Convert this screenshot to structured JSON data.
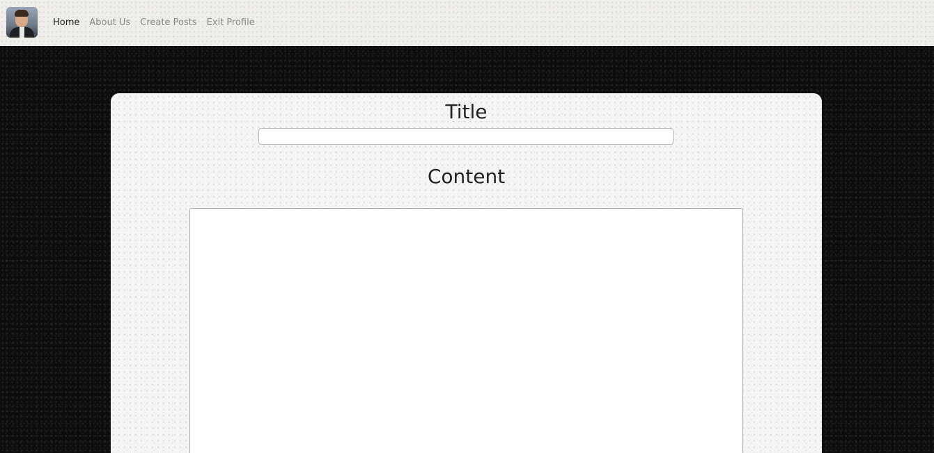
{
  "navbar": {
    "avatar_alt": "Profile photo",
    "links": [
      {
        "label": "Home",
        "active": true
      },
      {
        "label": "About Us",
        "active": false
      },
      {
        "label": "Create Posts",
        "active": false
      },
      {
        "label": "Exit Profile",
        "active": false
      }
    ]
  },
  "form": {
    "title_label": "Title",
    "title_value": "",
    "content_label": "Content",
    "content_value": ""
  },
  "colors": {
    "page_background": "#0d0d0d",
    "navbar_background": "#efeeeb",
    "card_background": "#f6f5f5",
    "active_link": "#222222",
    "inactive_link": "#888888"
  }
}
